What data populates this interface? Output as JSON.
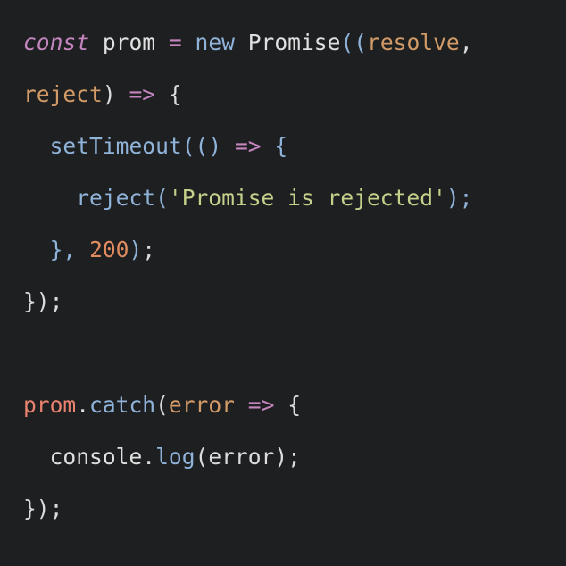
{
  "code": {
    "line1": {
      "kw_const": "const",
      "sp1": " ",
      "ident_prom": "prom",
      "eq": " = ",
      "kw_new": "new",
      "sp2": " ",
      "class_promise": "Promise",
      "open": "((",
      "param_resolve": "resolve",
      "comma": ","
    },
    "line2": {
      "param_reject": "reject",
      "close": ") ",
      "arrow": "=>",
      "brace": " {"
    },
    "line3": {
      "indent": "  ",
      "fn_settimeout": "setTimeout",
      "parens": "(()",
      "sp": " ",
      "arrow": "=>",
      "brace": " {"
    },
    "line4": {
      "indent": "    ",
      "fn_reject": "reject",
      "open": "(",
      "string": "'Promise is rejected'",
      "close": ");"
    },
    "line5": {
      "indent": "  ",
      "close_brace": "},",
      "sp": " ",
      "number": "200",
      "close_paren": ")",
      "semi": ";"
    },
    "line6": {
      "text": "});"
    },
    "line7": {
      "var_prom": "prom",
      "dot": ".",
      "fn_catch": "catch",
      "open": "(",
      "param_error": "error",
      "sp": " ",
      "arrow": "=>",
      "brace": " {"
    },
    "line8": {
      "indent": "  ",
      "obj_console": "console",
      "dot": ".",
      "fn_log": "log",
      "args": "(error);"
    },
    "line9": {
      "text": "});"
    }
  }
}
